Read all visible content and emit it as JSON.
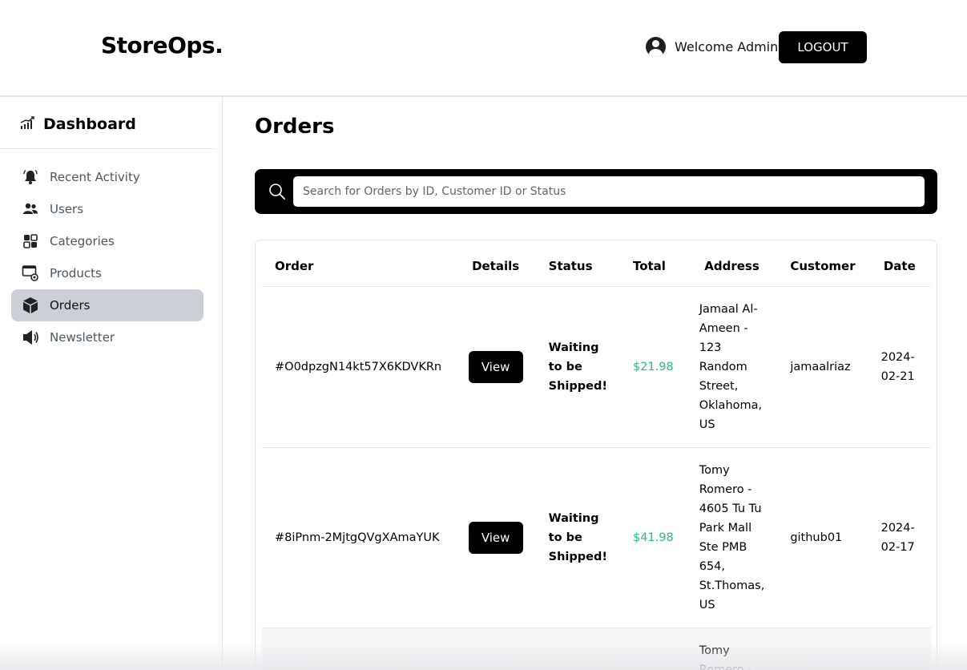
{
  "header": {
    "brand": "StoreOps.",
    "welcome": "Welcome Admin",
    "logout_label": "LOGOUT"
  },
  "sidebar": {
    "dashboard_label": "Dashboard",
    "items": [
      {
        "label": "Recent Activity",
        "icon": "bell-icon"
      },
      {
        "label": "Users",
        "icon": "users-icon"
      },
      {
        "label": "Categories",
        "icon": "categories-icon"
      },
      {
        "label": "Products",
        "icon": "products-icon"
      },
      {
        "label": "Orders",
        "icon": "box-icon",
        "active": true
      },
      {
        "label": "Newsletter",
        "icon": "megaphone-icon"
      }
    ]
  },
  "main": {
    "title": "Orders",
    "search": {
      "placeholder": "Search for Orders by ID, Customer ID or Status",
      "value": ""
    },
    "table": {
      "headers": [
        "Order",
        "Details",
        "Status",
        "Total",
        "Address",
        "Customer",
        "Date"
      ],
      "rows": [
        {
          "order": "#O0dpzgN14kt57X6KDVKRn",
          "details": "View",
          "status": "Waiting to be Shipped!",
          "total": "$21.98",
          "address": "Jamaal Al-Ameen - 123 Random Street, Oklahoma, US",
          "customer": "jamaalriaz",
          "date": "2024-02-21"
        },
        {
          "order": "#8iPnm-2MjtgQVgXAmaYUK",
          "details": "View",
          "status": "Waiting to be Shipped!",
          "total": "$41.98",
          "address": "Tomy Romero - 4605 Tu Tu Park Mall Ste PMB 654, St.Thomas, US",
          "customer": "github01",
          "date": "2024-02-17"
        },
        {
          "order": "",
          "details": "",
          "status": "",
          "total": "",
          "address": "Tomy Romero -",
          "customer": "",
          "date": ""
        }
      ]
    }
  },
  "colors": {
    "accent": "#000000",
    "total_green": "#22c07a",
    "active_nav": "#cbd0d6"
  }
}
